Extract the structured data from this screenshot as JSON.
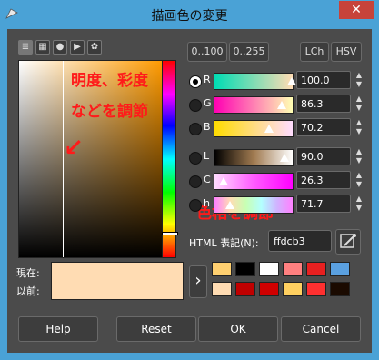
{
  "window": {
    "title": "描画色の変更",
    "close_glyph": "✕"
  },
  "tool_icons": [
    "color-scale-icon",
    "palette-icon",
    "watercolor-icon",
    "triangle-icon",
    "paint-palette-icon"
  ],
  "annotations": {
    "sv_area": "明度、彩度\nなどを調節",
    "arrow": "↙",
    "hue": "色相を調節"
  },
  "range_buttons": {
    "range_100": "0..100",
    "range_255": "0..255"
  },
  "mode_buttons": {
    "lch": "LCh",
    "hsv": "HSV"
  },
  "channels": [
    {
      "label": "R",
      "value": "100.0",
      "selected": true,
      "marker": 0.99,
      "gradient": "linear-gradient(to right,#00dcb3,#ffdcb3)"
    },
    {
      "label": "G",
      "value": "86.3",
      "selected": false,
      "marker": 0.86,
      "gradient": "linear-gradient(to right,#ff00b3,#ffffb3)"
    },
    {
      "label": "B",
      "value": "70.2",
      "selected": false,
      "marker": 0.7,
      "gradient": "linear-gradient(to right,#ffdc00,#ffdcff)"
    },
    {
      "label": "L",
      "value": "90.0",
      "selected": false,
      "marker": 0.9,
      "gradient": "linear-gradient(to right,#000,#a07a50,#ffffff)"
    },
    {
      "label": "C",
      "value": "26.3",
      "selected": false,
      "marker": 0.12,
      "gradient": "linear-gradient(to right,#ffdcff,#ff5cff,#ff00ff)"
    },
    {
      "label": "h",
      "value": "71.7",
      "selected": false,
      "marker": 0.2,
      "gradient": "linear-gradient(to right,#ff80ff,#ffdcb3,#c8ffb3,#b3ffff,#d0b3ff,#ff80ff)"
    }
  ],
  "html_notation": {
    "label": "HTML 表記(N):",
    "value": "ffdcb3"
  },
  "current": {
    "now_label": "現在:",
    "prev_label": "以前:",
    "color": "#ffdcb3"
  },
  "history_colors": [
    [
      "#ffd070",
      "#000000",
      "#ffffff",
      "#ff8080",
      "#e82020",
      "#5aa0e0"
    ],
    [
      "#ffdcb3",
      "#c00000",
      "#d00000",
      "#ffd060",
      "#ff3030",
      "#1a0a00"
    ]
  ],
  "buttons": {
    "help": "Help",
    "reset": "Reset",
    "ok": "OK",
    "cancel": "Cancel"
  }
}
